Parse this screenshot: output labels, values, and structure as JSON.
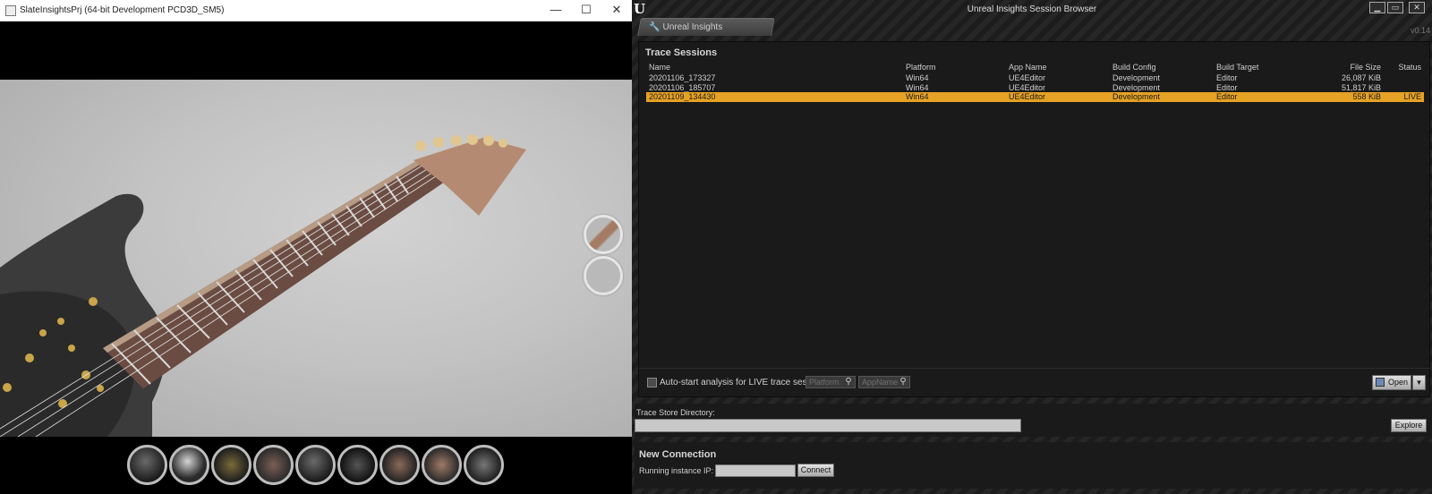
{
  "left_window": {
    "title": "SlateInsightsPrj (64-bit Development PCD3D_SM5)",
    "controls": {
      "minimize": "—",
      "maximize": "☐",
      "close": "✕"
    },
    "thumbnails": [
      "body",
      "headstock-light",
      "pickups",
      "neck",
      "strings",
      "body-side",
      "neck-angle",
      "fretboard",
      "body-back"
    ]
  },
  "right_window": {
    "title": "Unreal Insights Session Browser",
    "controls": {
      "minimize": "▁",
      "maximize": "▭",
      "close": "✕"
    },
    "tab_label": "Unreal Insights",
    "version": "v0.14",
    "sessions": {
      "title": "Trace Sessions",
      "columns": [
        "Name",
        "Platform",
        "App Name",
        "Build Config",
        "Build Target",
        "File Size",
        "Status"
      ],
      "rows": [
        {
          "name": "20201106_173327",
          "platform": "Win64",
          "app": "UE4Editor",
          "config": "Development",
          "target": "Editor",
          "size": "26,087 KiB",
          "status": "",
          "selected": false
        },
        {
          "name": "20201106_185707",
          "platform": "Win64",
          "app": "UE4Editor",
          "config": "Development",
          "target": "Editor",
          "size": "51,817 KiB",
          "status": "",
          "selected": false
        },
        {
          "name": "20201109_134430",
          "platform": "Win64",
          "app": "UE4Editor",
          "config": "Development",
          "target": "Editor",
          "size": "558 KiB",
          "status": "LIVE",
          "selected": true
        }
      ],
      "auto_start_label": "Auto-start analysis for LIVE trace sessions",
      "platform_placeholder": "Platform",
      "appname_placeholder": "AppName",
      "open_label": "Open"
    },
    "store": {
      "label": "Trace Store Directory:",
      "explore_label": "Explore"
    },
    "connection": {
      "title": "New Connection",
      "ip_label": "Running instance IP:",
      "connect_label": "Connect"
    }
  },
  "colors": {
    "selected_row": "#e6a224",
    "panel_bg": "#1a1a1a"
  }
}
